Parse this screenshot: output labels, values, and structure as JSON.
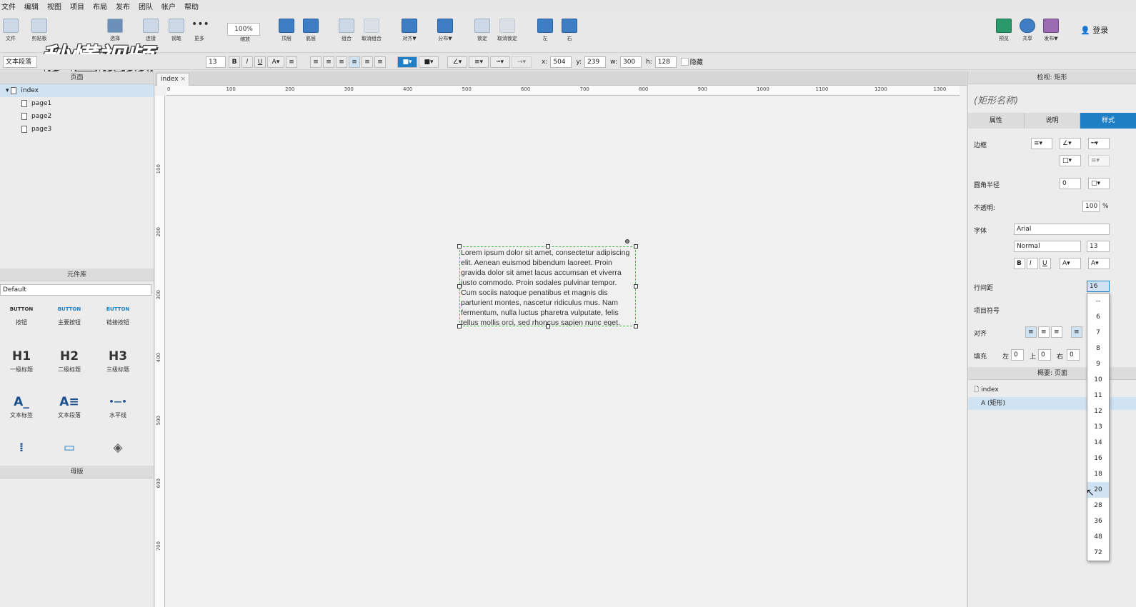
{
  "menu": [
    "文件",
    "编辑",
    "视图",
    "项目",
    "布局",
    "发布",
    "团队",
    "帐户",
    "帮助"
  ],
  "toolbar": {
    "zoom": "100%",
    "items": [
      "文件",
      "剪贴板",
      "选择",
      "连接",
      "钢笔",
      "更多",
      "缩放",
      "顶层",
      "底层",
      "组合",
      "取消组合",
      "对齐▼",
      "分布▼",
      "锁定",
      "取消锁定",
      "左",
      "右",
      "预览",
      "共享",
      "发布▼"
    ],
    "login": "登录"
  },
  "watermark": "秒懂视频",
  "formatbar": {
    "style_select": "文本段落",
    "font_size": "13",
    "bold": "B",
    "italic": "I",
    "underline": "U",
    "x_label": "x:",
    "x": "504",
    "y_label": "y:",
    "y": "239",
    "w_label": "w:",
    "w": "300",
    "h_label": "h:",
    "h": "128",
    "hide_label": "隐藏"
  },
  "pages_panel": {
    "title": "页面",
    "root": "index",
    "children": [
      "page1",
      "page2",
      "page3"
    ]
  },
  "library_panel": {
    "title": "元件库",
    "select": "Default",
    "items": [
      {
        "glyph": "BUTTON",
        "label": "按钮"
      },
      {
        "glyph": "BUTTON",
        "label": "主要按钮"
      },
      {
        "glyph": "BUTTON",
        "label": "链接按钮"
      },
      {
        "glyph": "H1",
        "label": "一级标题"
      },
      {
        "glyph": "H2",
        "label": "二级标题"
      },
      {
        "glyph": "H3",
        "label": "三级标题"
      },
      {
        "glyph": "A_",
        "label": "文本标签"
      },
      {
        "glyph": "A≡",
        "label": "文本段落"
      },
      {
        "glyph": "•—•",
        "label": "水平线"
      }
    ]
  },
  "masters_panel": {
    "title": "母版"
  },
  "canvas": {
    "tab": "index",
    "ruler_h": [
      "0",
      "100",
      "200",
      "300",
      "400",
      "500",
      "600",
      "700",
      "800",
      "900",
      "1000",
      "1100",
      "1200",
      "1300"
    ],
    "ruler_v": [
      "100",
      "200",
      "300",
      "400",
      "500",
      "600",
      "700"
    ],
    "text": "Lorem ipsum dolor sit amet, consectetur adipiscing elit. Aenean euismod bibendum laoreet. Proin gravida dolor sit amet lacus accumsan et viverra justo commodo. Proin sodales pulvinar tempor. Cum sociis natoque penatibus et magnis dis parturient montes, nascetur ridiculus mus. Nam fermentum, nulla luctus pharetra vulputate, felis tellus mollis orci, sed rhoncus sapien nunc eget."
  },
  "inspector": {
    "title": "检视: 矩形",
    "shape_name": "(矩形名称)",
    "tabs": [
      "属性",
      "说明",
      "样式"
    ],
    "border_label": "边框",
    "radius_label": "圆角半径",
    "radius": "0",
    "opacity_label": "不透明:",
    "opacity": "100",
    "opacity_unit": "%",
    "font_label": "字体",
    "font": "Arial",
    "weight": "Normal",
    "size": "13",
    "line_height_label": "行间距",
    "line_height_value": "16",
    "bullet_label": "项目符号",
    "align_label": "对齐",
    "padding_label": "填充",
    "pad_left_label": "左",
    "pad_left": "0",
    "pad_top_label": "上",
    "pad_top": "0",
    "pad_right_label": "右",
    "pad_right": "0"
  },
  "outline": {
    "title": "概要: 页面",
    "page": "index",
    "item": "(矩形)"
  },
  "line_height_options": [
    "--",
    "6",
    "7",
    "8",
    "9",
    "10",
    "11",
    "12",
    "13",
    "14",
    "16",
    "18",
    "20",
    "28",
    "36",
    "48",
    "72"
  ],
  "colors": {
    "accent": "#1f7fc4",
    "selection": "#4cb84c"
  }
}
